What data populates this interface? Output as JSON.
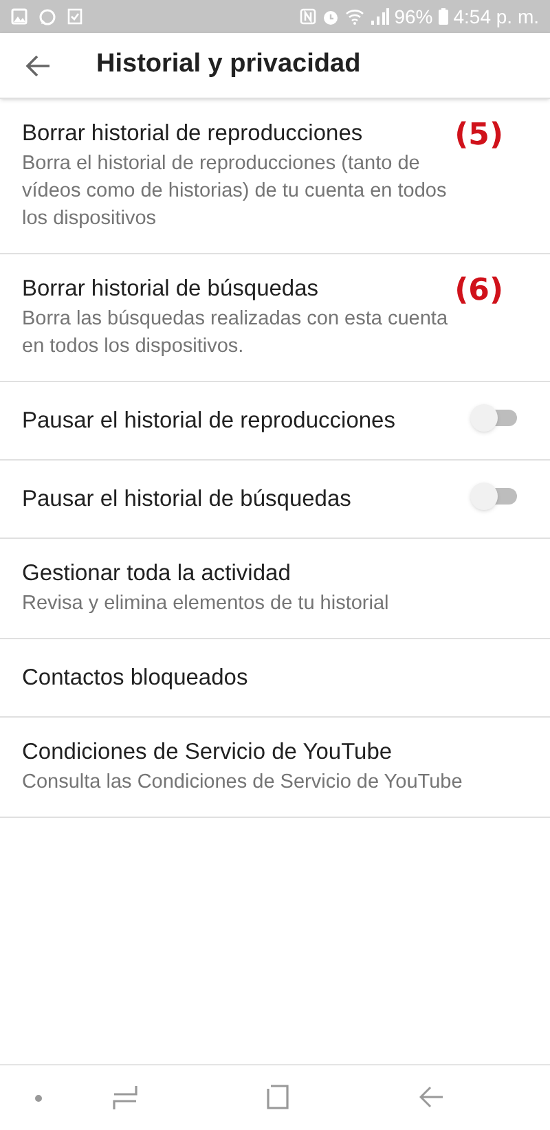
{
  "status_bar": {
    "battery": "96%",
    "time": "4:54 p. m."
  },
  "header": {
    "title": "Historial y privacidad"
  },
  "items": [
    {
      "kind": "text",
      "title": "Borrar historial de reproducciones",
      "subtitle": "Borra el historial de reproducciones (tanto de vídeos como de historias) de tu cuenta en todos los dispositivos",
      "annotation": "(5)"
    },
    {
      "kind": "text",
      "title": "Borrar historial de búsquedas",
      "subtitle": "Borra las búsquedas realizadas con esta cuenta en todos los dispositivos.",
      "annotation": "(6)"
    },
    {
      "kind": "toggle",
      "title": "Pausar el historial de reproducciones",
      "on": false
    },
    {
      "kind": "toggle",
      "title": "Pausar el historial de búsquedas",
      "on": false
    },
    {
      "kind": "text",
      "title": "Gestionar toda la actividad",
      "subtitle": "Revisa y elimina elementos de tu historial"
    },
    {
      "kind": "text",
      "title": "Contactos bloqueados"
    },
    {
      "kind": "text",
      "title": "Condiciones de Servicio de YouTube",
      "subtitle": "Consulta las Condiciones de Servicio de YouTube"
    }
  ]
}
